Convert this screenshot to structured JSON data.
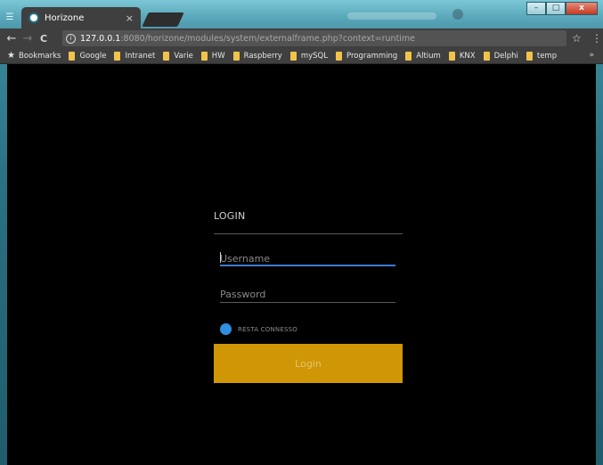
{
  "browser": {
    "tab_title": "Horizone",
    "tab_close": "×",
    "url_host": "127.0.0.1",
    "url_rest": ":8080/horizone/modules/system/externalframe.php?context=runtime",
    "nav_back": "←",
    "nav_forward": "→",
    "nav_reload": "C",
    "star": "☆",
    "menu": "⋮",
    "win_min": "–",
    "win_max": "□",
    "win_close": "x"
  },
  "bookmarks": {
    "root_label": "Bookmarks",
    "items": [
      "Google",
      "Intranet",
      "Varie",
      "HW",
      "Raspberry",
      "mySQL",
      "Programming",
      "Altium",
      "KNX",
      "Delphi",
      "temp"
    ],
    "more": "»"
  },
  "login": {
    "title": "LOGIN",
    "username_placeholder": "Username",
    "password_placeholder": "Password",
    "remember_label": "RESTA CONNESSO",
    "button_label": "Login"
  },
  "colors": {
    "accent_button": "#cf9606",
    "focus_line": "#3b7bd4",
    "radio": "#2f8fe0"
  }
}
